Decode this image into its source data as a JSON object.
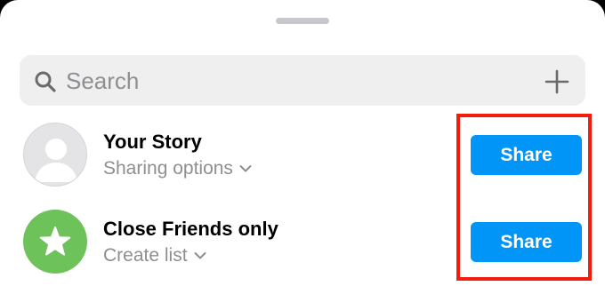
{
  "search": {
    "placeholder": "Search",
    "icon": "search-icon",
    "add_icon": "plus-icon"
  },
  "items": [
    {
      "title": "Your Story",
      "subtitle": "Sharing options",
      "button": "Share",
      "avatar": "default-profile-avatar",
      "avatar_color": "#e4e4e6"
    },
    {
      "title": "Close Friends only",
      "subtitle": "Create list",
      "button": "Share",
      "avatar": "star-icon",
      "avatar_color": "#6ec25a"
    }
  ],
  "colors": {
    "share_button": "#0095f6",
    "highlight_box": "#f41c0c"
  }
}
